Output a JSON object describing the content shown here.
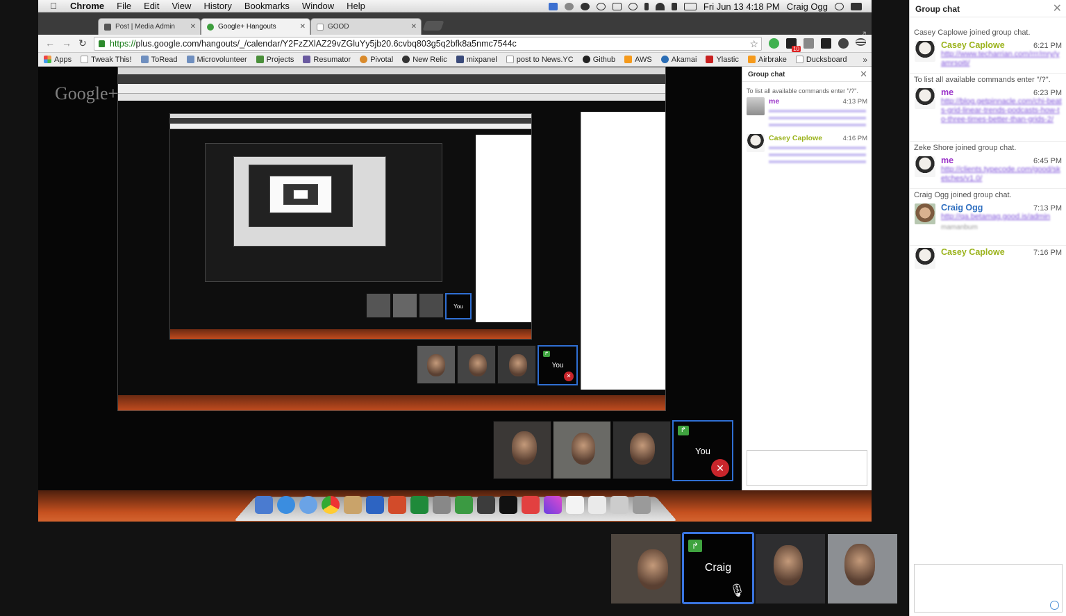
{
  "menubar": {
    "app": "Chrome",
    "menus": [
      "File",
      "Edit",
      "View",
      "History",
      "Bookmarks",
      "Window",
      "Help"
    ],
    "clock": "Fri Jun 13  4:18 PM",
    "user": "Craig Ogg"
  },
  "browser": {
    "tabs": [
      {
        "title": "Post | Media Admin"
      },
      {
        "title": "Google+ Hangouts"
      },
      {
        "title": "GOOD"
      }
    ],
    "url_scheme": "https://",
    "url_rest": "plus.google.com/hangouts/_/calendar/Y2FzZXlAZ29vZGluYy5jb20.6cvbq803g5q2bfk8a5nmc7544c",
    "ext_badge": "10",
    "bookmarks": [
      "Apps",
      "Tweak This!",
      "ToRead",
      "Microvolunteer",
      "Projects",
      "Resumator",
      "Pivotal",
      "New Relic",
      "mixpanel",
      "post to News.YC",
      "Github",
      "AWS",
      "Akamai",
      "Ylastic",
      "Airbrake",
      "Ducksboard"
    ],
    "more": "»"
  },
  "logo_text": "Google+",
  "nested_chat": {
    "title": "Group chat",
    "info": "To list all available commands enter \"/?\".",
    "messages": [
      {
        "author": "me",
        "time": "4:13 PM"
      },
      {
        "author": "Casey Caplowe",
        "time": "4:16 PM"
      }
    ]
  },
  "screen_thumbs": {
    "you_label": "You"
  },
  "participants": {
    "active_name": "Craig"
  },
  "sidebar": {
    "title": "Group chat",
    "close": "✕",
    "feed": [
      {
        "kind": "notice",
        "text": "Casey Caplowe joined group chat."
      },
      {
        "kind": "msg",
        "author": "Casey Caplowe",
        "color": "#9bb31c",
        "time": "6:21 PM",
        "link": "http://www.techarrian.com/rrr/mry/yamrsoiti/",
        "sub": ""
      },
      {
        "kind": "notice",
        "text": "To list all available commands enter \"/?\"."
      },
      {
        "kind": "msg",
        "author": "me",
        "color": "#9b34c9",
        "time": "6:23 PM",
        "link": "http://blog.getpinnacle.com/chi-beats-grid-linear-trends-podcasts-how-to-three-times-better-than-grids-2/",
        "sub": ""
      },
      {
        "kind": "notice",
        "text": "Zeke Shore joined group chat."
      },
      {
        "kind": "msg",
        "author": "me",
        "color": "#9b34c9",
        "time": "6:45 PM",
        "link": "http://clients.typecode.com/good/sketches/v1.0/",
        "sub": ""
      },
      {
        "kind": "notice",
        "text": "Craig Ogg joined group chat."
      },
      {
        "kind": "msg",
        "author": "Craig Ogg",
        "color": "#2f6fc0",
        "time": "7:13 PM",
        "link": "http://qa.betamag.good.is/admin",
        "sub": "mamanbum"
      },
      {
        "kind": "msg",
        "author": "Casey Caplowe",
        "color": "#9bb31c",
        "time": "7:16 PM",
        "link": "",
        "sub": ""
      }
    ]
  }
}
